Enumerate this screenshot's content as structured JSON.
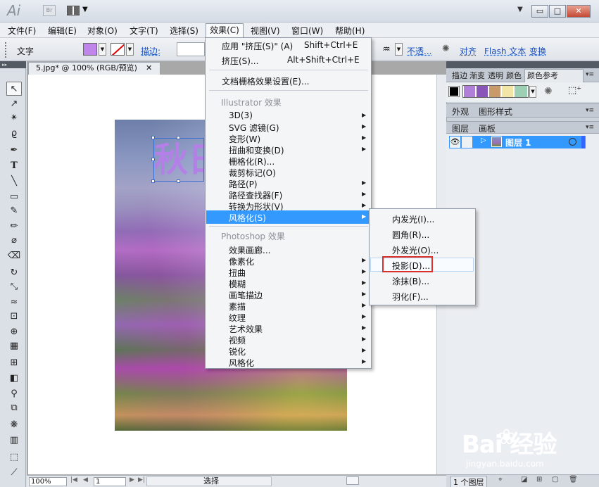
{
  "app": {
    "logo": "Ai",
    "bridge_badge": "Br"
  },
  "window_controls": {
    "minimize": "▭",
    "maximize": "□",
    "close": "✕"
  },
  "menubar": [
    "文件(F)",
    "编辑(E)",
    "对象(O)",
    "文字(T)",
    "选择(S)",
    "效果(C)",
    "视图(V)",
    "窗口(W)",
    "帮助(H)"
  ],
  "control_bar": {
    "label": "文字",
    "fill_color": "#c085ea",
    "stroke_label": "描边:",
    "opacity_label": "不透...",
    "align_label": "对齐",
    "flash_text_label": "Flash 文本",
    "transform_label": "变换"
  },
  "document": {
    "tab_title": "5.jpg* @ 100% (RGB/预览)",
    "close": "✕",
    "artwork_text": "秋日"
  },
  "effect_menu": {
    "apply_last": {
      "label": "应用 \"挤压(S)\" (A)",
      "shortcut": "Shift+Ctrl+E"
    },
    "last_effect": {
      "label": "挤压(S)...",
      "shortcut": "Alt+Shift+Ctrl+E"
    },
    "raster_settings": "文档栅格效果设置(E)...",
    "illustrator_group": "Illustrator 效果",
    "illustrator_items": [
      "3D(3)",
      "SVG 滤镜(G)",
      "变形(W)",
      "扭曲和变换(D)",
      "栅格化(R)...",
      "裁剪标记(O)",
      "路径(P)",
      "路径查找器(F)",
      "转换为形状(V)",
      "风格化(S)"
    ],
    "photoshop_group": "Photoshop 效果",
    "photoshop_items": [
      "效果画廊...",
      "像素化",
      "扭曲",
      "模糊",
      "画笔描边",
      "素描",
      "纹理",
      "艺术效果",
      "视频",
      "锐化",
      "风格化"
    ]
  },
  "stylize_submenu": [
    "内发光(I)...",
    "圆角(R)...",
    "外发光(O)...",
    "投影(D)...",
    "涂抹(B)...",
    "羽化(F)..."
  ],
  "right_panel": {
    "tabs_top": [
      "描边",
      "渐变",
      "透明",
      "颜色",
      "颜色参考"
    ],
    "guide_colors": [
      "#b07fd8",
      "#8a55b8",
      "#c89a6a",
      "#f2e6a6",
      "#9dcfb4"
    ],
    "tabs_middle": [
      "外观",
      "图形样式"
    ],
    "tabs_layers": [
      "图层",
      "画板"
    ],
    "layer_name": "图层 1",
    "layers_count": "1 个图层"
  },
  "status_bar": {
    "zoom": "100%",
    "page": "1",
    "status": "选择"
  },
  "watermark": {
    "main": "Bai  经验",
    "sub": "jingyan.baidu.com"
  }
}
